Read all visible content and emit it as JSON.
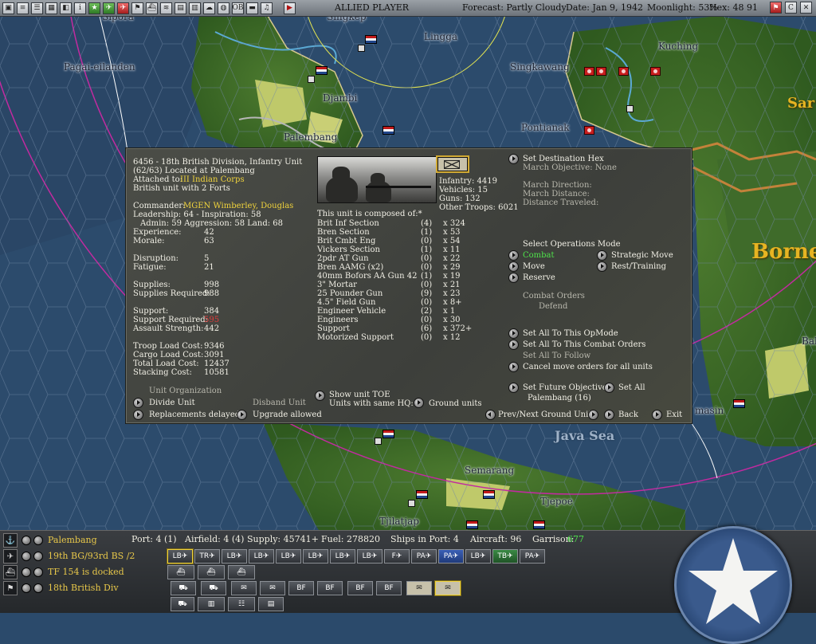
{
  "top_bar": {
    "player": "ALLIED PLAYER",
    "forecast": "Forecast: Partly Cloudy",
    "date": "Date: Jan 9, 1942",
    "moonlight": "Moonlight: 53%",
    "hex": "Hex: 48 91"
  },
  "map_labels": {
    "sipora": "Sipora",
    "singkep": "Singkep",
    "lingga": "Lingga",
    "kuching": "Kuching",
    "pagai": "Pagai-eilanden",
    "singkawang": "Singkawang",
    "djambi": "Djambi",
    "pontianak": "Pontianak",
    "palembang": "Palembang",
    "borneo": "Borne",
    "sar": "Sar",
    "bal": "Bal",
    "masin": "masin",
    "java_sea": "Java Sea",
    "semarang": "Semarang",
    "tjepoe": "Tjepoe",
    "tjilatjap": "Tjilatjap"
  },
  "unit": {
    "title": "6456 - 18th British Division, Infantry Unit",
    "located": "(62/63) Located at Palembang",
    "attached_label": "Attached to:",
    "attached_value": "III Indian Corps",
    "forts": "British unit with 2 Forts",
    "commander_label": "Commander:",
    "commander_value": "MGEN Wimberley, Douglas",
    "leadership": "Leadership: 64 - Inspiration: 58",
    "admin": "Admin: 59  Aggression: 58  Land: 68",
    "stats": [
      {
        "label": "Experience:",
        "value": "42",
        "highlight": false
      },
      {
        "label": "Morale:",
        "value": "63",
        "highlight": false
      },
      {
        "label": "Disruption:",
        "value": "5",
        "highlight": false
      },
      {
        "label": "Fatigue:",
        "value": "21",
        "highlight": false
      },
      {
        "label": "Supplies:",
        "value": "998",
        "highlight": false
      },
      {
        "label": "Supplies Required:",
        "value": "988",
        "highlight": false
      },
      {
        "label": "Support:",
        "value": "384",
        "highlight": false
      },
      {
        "label": "Support Required:",
        "value": "595",
        "highlight": true
      },
      {
        "label": "Assault Strength:",
        "value": "442",
        "highlight": false
      },
      {
        "label": "Troop Load Cost:",
        "value": "9346",
        "highlight": false
      },
      {
        "label": "Cargo Load Cost:",
        "value": "3091",
        "highlight": false
      },
      {
        "label": "Total Load Cost:",
        "value": "12437",
        "highlight": false
      },
      {
        "label": "Stacking Cost:",
        "value": "10581",
        "highlight": false
      }
    ],
    "org_header": "Unit Organization",
    "divide_unit": "Divide Unit",
    "disband_unit": "Disband Unit",
    "replacements": "Replacements delayed",
    "upgrade": "Upgrade allowed",
    "show_toe": "Show unit TOE",
    "same_hq": "Units with same HQ:",
    "ground_units": "Ground units",
    "summary": {
      "infantry": "Infantry: 4419",
      "vehicles": "Vehicles: 15",
      "guns": "Guns: 132",
      "other": "Other Troops: 6021"
    },
    "composed_header": "This unit is composed of:*",
    "composition": [
      {
        "name": "Brit Inf Section",
        "count": "(4)",
        "qty": "x 324"
      },
      {
        "name": "Bren Section",
        "count": "(1)",
        "qty": "x 53"
      },
      {
        "name": "Brit Cmbt Eng",
        "count": "(0)",
        "qty": "x 54"
      },
      {
        "name": "Vickers Section",
        "count": "(1)",
        "qty": "x 11"
      },
      {
        "name": "2pdr AT Gun",
        "count": "(0)",
        "qty": "x 22"
      },
      {
        "name": "Bren AAMG (x2)",
        "count": "(0)",
        "qty": "x 29"
      },
      {
        "name": "40mm Bofors AA Gun  42",
        "count": "(1)",
        "qty": "x 19"
      },
      {
        "name": "3\" Mortar",
        "count": "(0)",
        "qty": "x 21"
      },
      {
        "name": "25 Pounder Gun",
        "count": "(9)",
        "qty": "x 23"
      },
      {
        "name": "4.5\" Field Gun",
        "count": "(0)",
        "qty": "x 8+"
      },
      {
        "name": "Engineer Vehicle",
        "count": "(2)",
        "qty": "x 1"
      },
      {
        "name": "Engineers",
        "count": "(0)",
        "qty": "x 30"
      },
      {
        "name": "Support",
        "count": "(6)",
        "qty": "x 372+"
      },
      {
        "name": "Motorized Support",
        "count": "(0)",
        "qty": "x 12"
      }
    ],
    "right": {
      "set_destination": "Set Destination Hex",
      "march_objective": "March Objective: None",
      "march_direction": "March Direction:",
      "march_distance": "March Distance:",
      "distance_traveled": "Distance Traveled:",
      "ops_header": "Select Operations Mode",
      "combat": "Combat",
      "strategic_move": "Strategic Move",
      "move": "Move",
      "rest": "Rest/Training",
      "reserve": "Reserve",
      "combat_orders": "Combat Orders",
      "defend": "Defend",
      "set_all_opmode": "Set All To This OpMode",
      "set_all_combat": "Set All To This Combat Orders",
      "set_all_follow": "Set All To Follow",
      "cancel_moves": "Cancel move orders for all units",
      "set_future": "Set Future Objective",
      "set_all": "Set All",
      "future_value": "Palembang (16)",
      "prev_next": "Prev/Next Ground Unit",
      "back": "Back",
      "exit": "Exit"
    }
  },
  "bottom": {
    "rows": [
      {
        "label": "Palembang",
        "icon": "anchor-icon"
      },
      {
        "label": "19th BG/93rd BS /2",
        "icon": "plane-icon"
      },
      {
        "label": "TF 154 is docked",
        "icon": "ship-icon"
      },
      {
        "label": "18th British Div",
        "icon": "flag-icon"
      }
    ],
    "port": "Port: 4 (1)",
    "airfield": "Airfield: 4 (4)",
    "supply": "Supply: 45741+",
    "fuel": "Fuel: 278820",
    "ships": "Ships in Port: 4",
    "aircraft": "Aircraft: 96",
    "garrison_label": "Garrison:",
    "garrison_value": "677",
    "air_slots": [
      "LB",
      "TR",
      "LB",
      "LB",
      "LB",
      "LB",
      "LB",
      "LB",
      "F",
      "PA",
      "PA",
      "LB",
      "TB",
      "PA"
    ],
    "ground_slots": [
      "",
      "",
      "",
      "",
      "BF",
      "BF",
      "BF",
      "BF",
      "",
      ""
    ]
  }
}
